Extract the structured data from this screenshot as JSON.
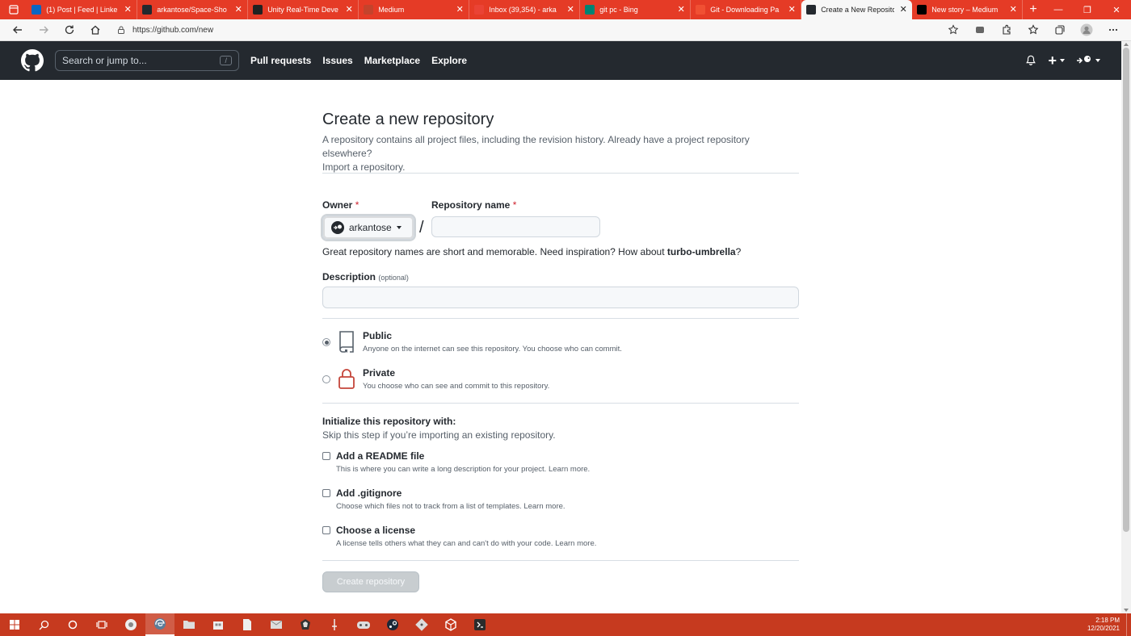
{
  "browser": {
    "tabs": [
      {
        "title": "(1) Post | Feed | Linke",
        "icon": "linkedin-icon",
        "color": "#0a66c2",
        "active": false
      },
      {
        "title": "arkantose/Space-Sho",
        "icon": "github-icon",
        "color": "#24292f",
        "active": false
      },
      {
        "title": "Unity Real-Time Deve",
        "icon": "unity-icon",
        "color": "#222222",
        "active": false
      },
      {
        "title": "Medium",
        "icon": "medium-icon",
        "color": "#c4432c",
        "active": false
      },
      {
        "title": "Inbox (39,354) - arka",
        "icon": "gmail-icon",
        "color": "#ea4335",
        "active": false
      },
      {
        "title": "git pc - Bing",
        "icon": "bing-icon",
        "color": "#008373",
        "active": false
      },
      {
        "title": "Git - Downloading Pa",
        "icon": "git-icon",
        "color": "#f05033",
        "active": false
      },
      {
        "title": "Create a New Reposito",
        "icon": "github-icon",
        "color": "#24292f",
        "active": true
      },
      {
        "title": "New story – Medium",
        "icon": "medium-icon",
        "color": "#000000",
        "active": false
      }
    ],
    "new_tab": "+",
    "url": "https://github.com/new"
  },
  "header": {
    "search_placeholder": "Search or jump to...",
    "search_shortcut": "/",
    "nav": [
      "Pull requests",
      "Issues",
      "Marketplace",
      "Explore"
    ],
    "plus": "+"
  },
  "form": {
    "title": "Create a new repository",
    "subtitle": "A repository contains all project files, including the revision history. Already have a project repository elsewhere?",
    "import_link": "Import a repository.",
    "owner_label": "Owner",
    "repo_label": "Repository name",
    "required_mark": "*",
    "owner_value": "arkantose",
    "separator": "/",
    "repo_value": "",
    "hint_prefix": "Great repository names are short and memorable. Need inspiration? How about",
    "hint_suggestion": "turbo-umbrella",
    "hint_suffix": "?",
    "description_label": "Description",
    "description_optional": "(optional)",
    "description_value": "",
    "visibility": [
      {
        "title": "Public",
        "desc": "Anyone on the internet can see this repository. You choose who can commit.",
        "checked": true,
        "icon": "repo-icon"
      },
      {
        "title": "Private",
        "desc": "You choose who can see and commit to this repository.",
        "checked": false,
        "icon": "lock-icon"
      }
    ],
    "init_title": "Initialize this repository with:",
    "init_sub": "Skip this step if you’re importing an existing repository.",
    "init_options": [
      {
        "title": "Add a README file",
        "desc": "This is where you can write a long description for your project.",
        "link": "Learn more.",
        "checked": false
      },
      {
        "title": "Add .gitignore",
        "desc": "Choose which files not to track from a list of templates.",
        "link": "Learn more.",
        "checked": false
      },
      {
        "title": "Choose a license",
        "desc": "A license tells others what they can and can't do with your code.",
        "link": "Learn more.",
        "checked": false
      }
    ],
    "submit": "Create repository"
  },
  "taskbar": {
    "time": "2:18 PM",
    "date": "12/20/2021",
    "accent": "#c63a1f"
  }
}
